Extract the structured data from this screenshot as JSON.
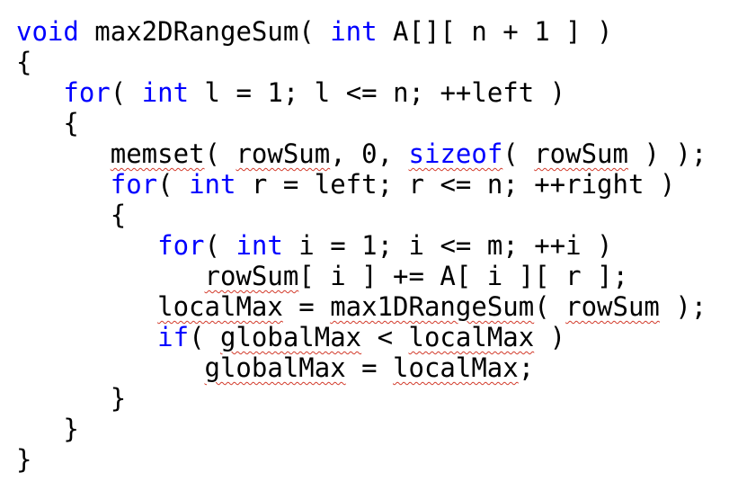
{
  "colors": {
    "keyword": "#0000ff",
    "text": "#000000",
    "squiggle": "#d23a2a"
  },
  "code": {
    "lines": [
      {
        "indent": "",
        "tokens": [
          {
            "t": "void",
            "k": "kw"
          },
          {
            "t": " max2DRangeSum( ",
            "k": ""
          },
          {
            "t": "int",
            "k": "kw"
          },
          {
            "t": " A[][ n + 1 ] )",
            "k": ""
          }
        ]
      },
      {
        "indent": "",
        "tokens": [
          {
            "t": "{",
            "k": ""
          }
        ]
      },
      {
        "indent": "   ",
        "tokens": [
          {
            "t": "for",
            "k": "kw"
          },
          {
            "t": "( ",
            "k": ""
          },
          {
            "t": "int",
            "k": "kw"
          },
          {
            "t": " l = 1; l <= n; ++left )",
            "k": ""
          }
        ]
      },
      {
        "indent": "   ",
        "tokens": [
          {
            "t": "{",
            "k": ""
          }
        ]
      },
      {
        "indent": "      ",
        "tokens": [
          {
            "t": "memset",
            "k": "sq"
          },
          {
            "t": "( ",
            "k": ""
          },
          {
            "t": "rowSum",
            "k": "sq"
          },
          {
            "t": ", 0, ",
            "k": ""
          },
          {
            "t": "sizeof",
            "k": "kw sq"
          },
          {
            "t": "( ",
            "k": ""
          },
          {
            "t": "rowSum",
            "k": "sq"
          },
          {
            "t": " ) );",
            "k": ""
          }
        ]
      },
      {
        "indent": "      ",
        "tokens": [
          {
            "t": "for",
            "k": "kw"
          },
          {
            "t": "( ",
            "k": ""
          },
          {
            "t": "int",
            "k": "kw"
          },
          {
            "t": " r = left; r <= n; ++right )",
            "k": ""
          }
        ]
      },
      {
        "indent": "      ",
        "tokens": [
          {
            "t": "{",
            "k": ""
          }
        ]
      },
      {
        "indent": "         ",
        "tokens": [
          {
            "t": "for",
            "k": "kw"
          },
          {
            "t": "( ",
            "k": ""
          },
          {
            "t": "int",
            "k": "kw"
          },
          {
            "t": " i = 1; i <= m; ++i )",
            "k": ""
          }
        ]
      },
      {
        "indent": "            ",
        "tokens": [
          {
            "t": "rowSum",
            "k": "sq"
          },
          {
            "t": "[ i ] += A[ i ][ r ];",
            "k": ""
          }
        ]
      },
      {
        "indent": "         ",
        "tokens": [
          {
            "t": "localMax",
            "k": "sq"
          },
          {
            "t": " = ",
            "k": ""
          },
          {
            "t": "max1DRangeSum",
            "k": "sq"
          },
          {
            "t": "( ",
            "k": ""
          },
          {
            "t": "rowSum",
            "k": "sq"
          },
          {
            "t": " );",
            "k": ""
          }
        ]
      },
      {
        "indent": "         ",
        "tokens": [
          {
            "t": "if",
            "k": "kw"
          },
          {
            "t": "( ",
            "k": ""
          },
          {
            "t": "globalMax",
            "k": "sq"
          },
          {
            "t": " < ",
            "k": ""
          },
          {
            "t": "localMax",
            "k": "sq"
          },
          {
            "t": " )",
            "k": ""
          }
        ]
      },
      {
        "indent": "            ",
        "tokens": [
          {
            "t": "globalMax",
            "k": "sq"
          },
          {
            "t": " = ",
            "k": ""
          },
          {
            "t": "localMax",
            "k": "sq"
          },
          {
            "t": ";",
            "k": ""
          }
        ]
      },
      {
        "indent": "      ",
        "tokens": [
          {
            "t": "}",
            "k": ""
          }
        ]
      },
      {
        "indent": "   ",
        "tokens": [
          {
            "t": "}",
            "k": ""
          }
        ]
      },
      {
        "indent": "",
        "tokens": [
          {
            "t": "}",
            "k": ""
          }
        ]
      }
    ]
  }
}
